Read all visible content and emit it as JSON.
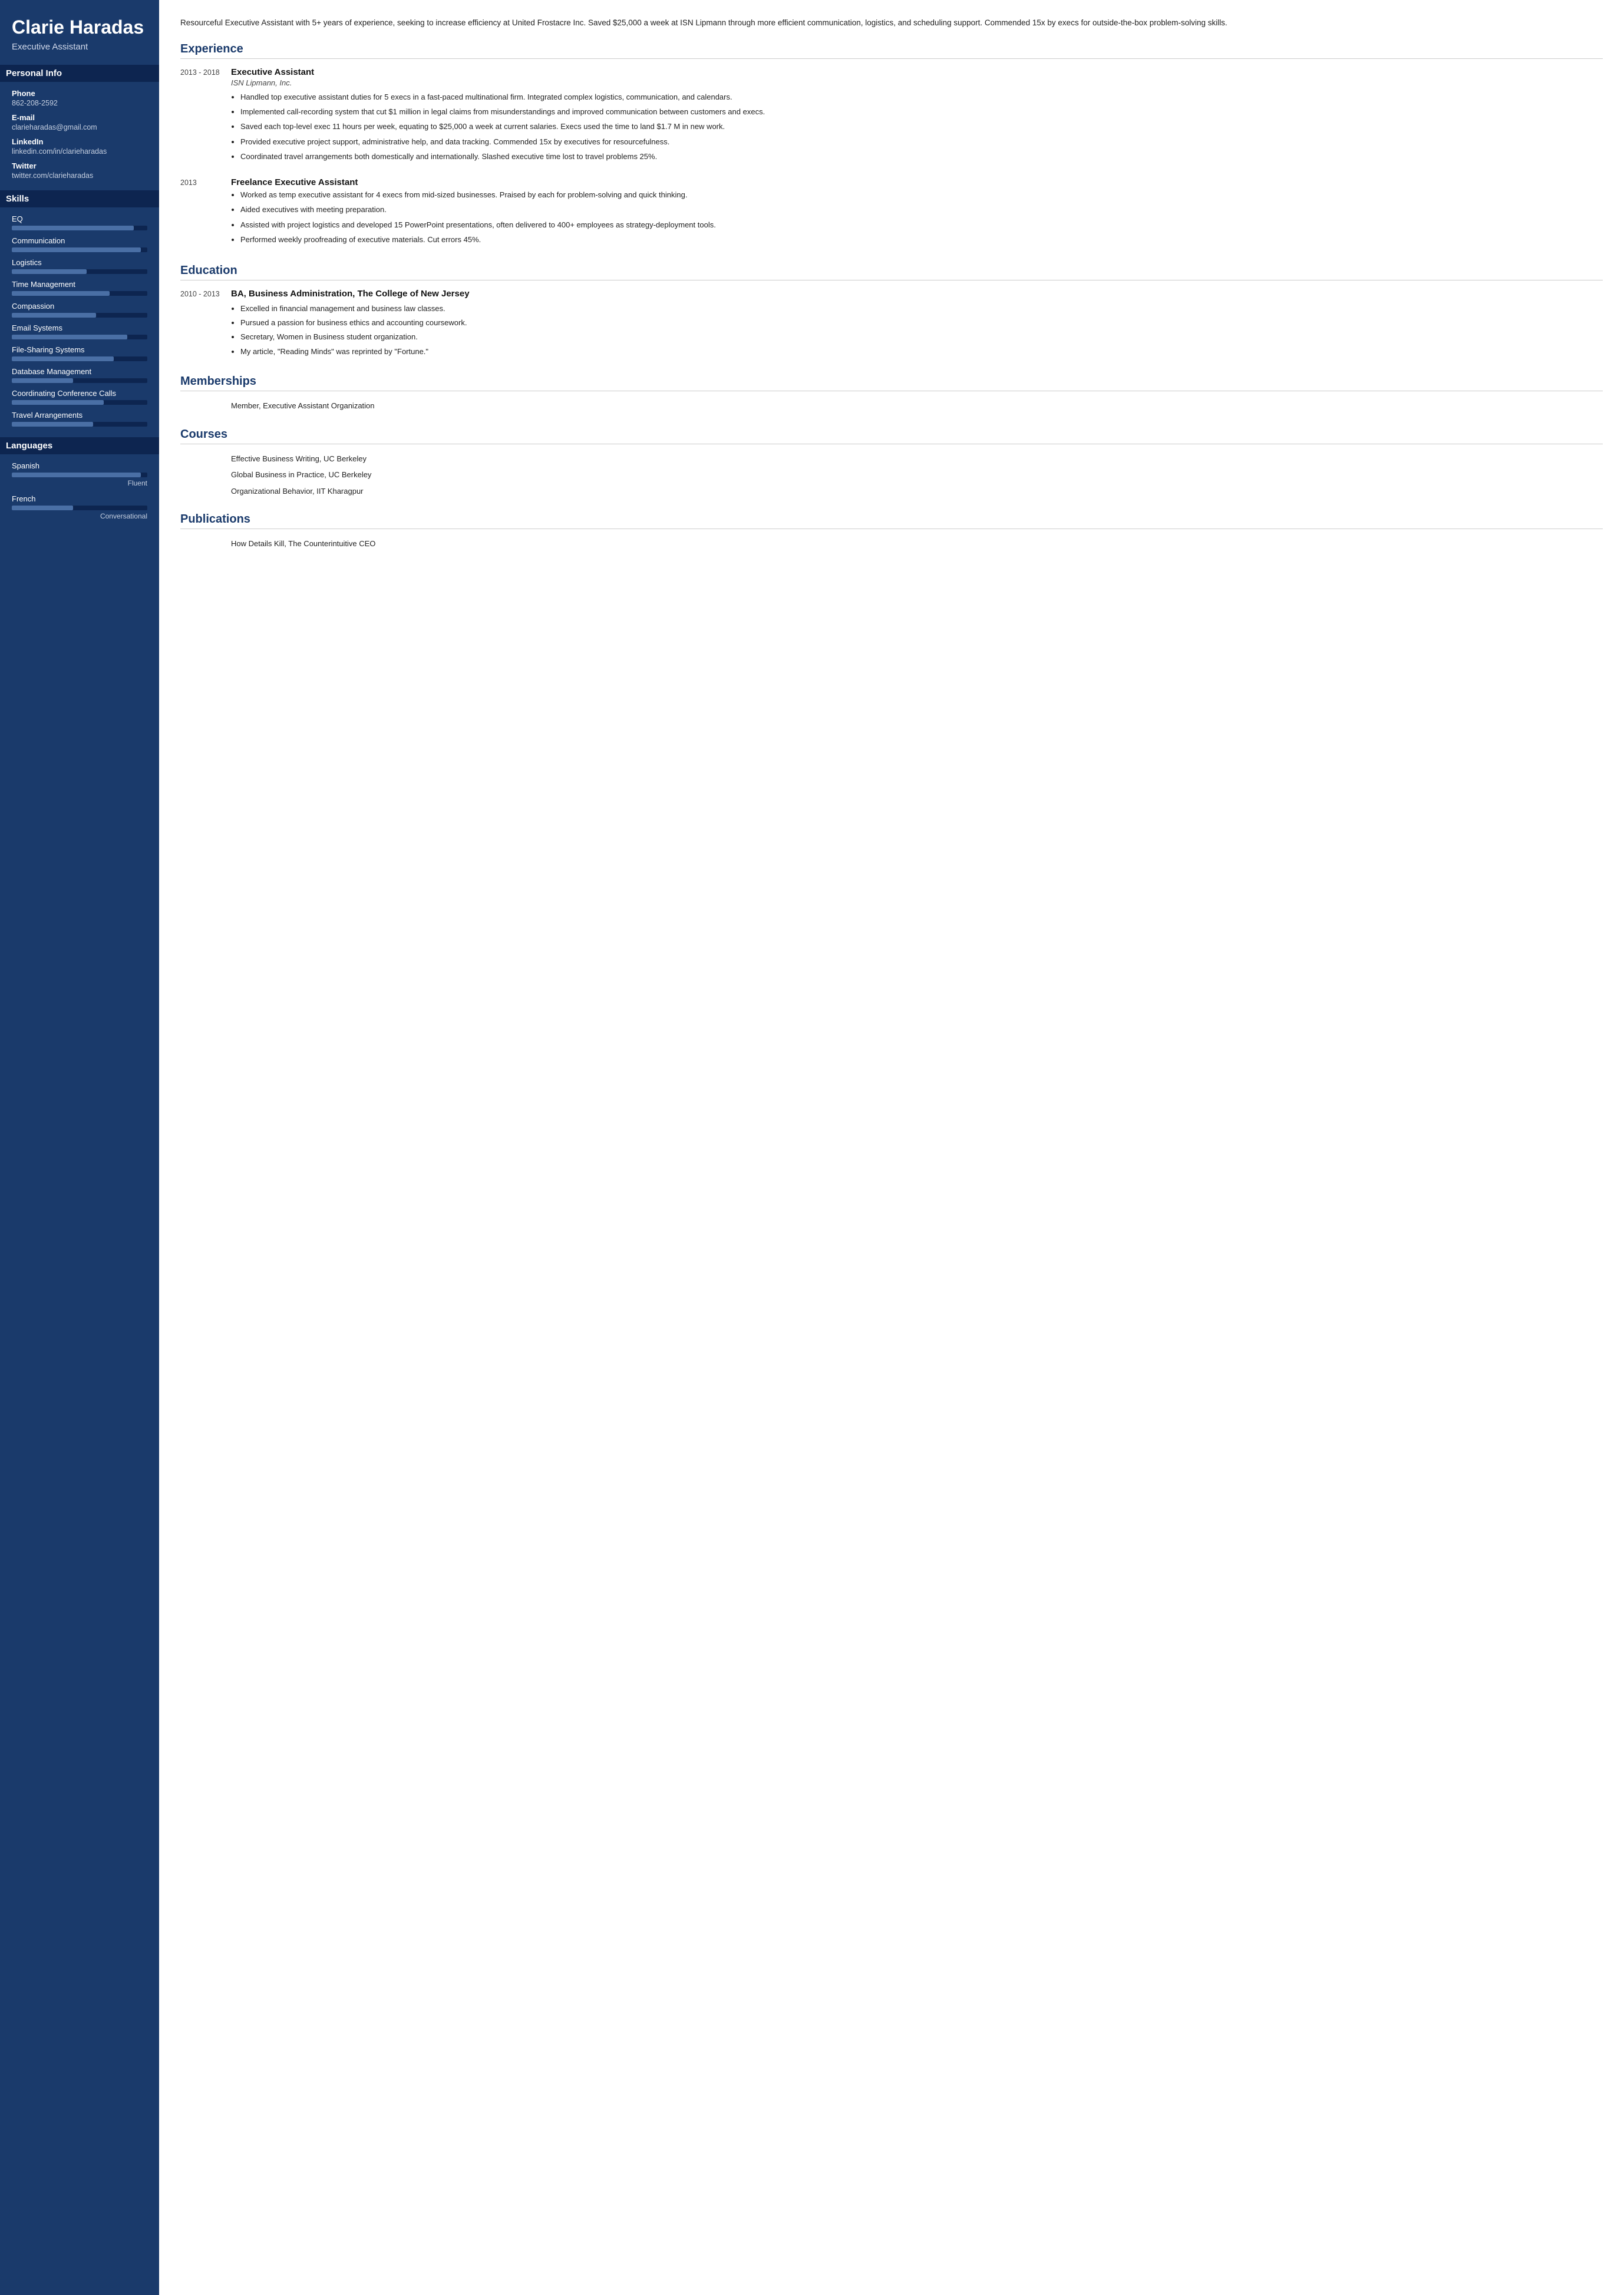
{
  "sidebar": {
    "name": "Clarie Haradas",
    "title": "Executive Assistant",
    "sections": {
      "personal_info": {
        "label": "Personal Info",
        "items": [
          {
            "label": "Phone",
            "value": "862-208-2592"
          },
          {
            "label": "E-mail",
            "value": "clarieharadas@gmail.com"
          },
          {
            "label": "LinkedIn",
            "value": "linkedin.com/in/clarieharadas"
          },
          {
            "label": "Twitter",
            "value": "twitter.com/clarieharadas"
          }
        ]
      },
      "skills": {
        "label": "Skills",
        "items": [
          {
            "name": "EQ",
            "pct": 90
          },
          {
            "name": "Communication",
            "pct": 95
          },
          {
            "name": "Logistics",
            "pct": 55
          },
          {
            "name": "Time Management",
            "pct": 72
          },
          {
            "name": "Compassion",
            "pct": 62
          },
          {
            "name": "Email Systems",
            "pct": 85
          },
          {
            "name": "File-Sharing Systems",
            "pct": 75
          },
          {
            "name": "Database Management",
            "pct": 45
          },
          {
            "name": "Coordinating Conference Calls",
            "pct": 68
          },
          {
            "name": "Travel Arrangements",
            "pct": 60
          }
        ]
      },
      "languages": {
        "label": "Languages",
        "items": [
          {
            "name": "Spanish",
            "pct": 95,
            "level": "Fluent"
          },
          {
            "name": "French",
            "pct": 45,
            "level": "Conversational"
          }
        ]
      }
    }
  },
  "main": {
    "summary": "Resourceful Executive Assistant with 5+ years of experience, seeking to increase efficiency at United Frostacre Inc. Saved $25,000 a week at ISN Lipmann through more efficient communication, logistics, and scheduling support. Commended 15x by execs for outside-the-box problem-solving skills.",
    "experience": {
      "label": "Experience",
      "entries": [
        {
          "dates": "2013 - 2018",
          "title": "Executive Assistant",
          "company": "ISN Lipmann, Inc.",
          "bullets": [
            "Handled top executive assistant duties for 5 execs in a fast-paced multinational firm. Integrated complex logistics, communication, and calendars.",
            "Implemented call-recording system that cut $1 million in legal claims from misunderstandings and improved communication between customers and execs.",
            "Saved each top-level exec 11 hours per week, equating to $25,000 a week at current salaries. Execs used the time to land $1.7 M in new work.",
            "Provided executive project support, administrative help, and data tracking. Commended 15x by executives for resourcefulness.",
            "Coordinated travel arrangements both domestically and internationally. Slashed executive time lost to travel problems 25%."
          ]
        },
        {
          "dates": "2013",
          "title": "Freelance Executive Assistant",
          "company": "",
          "bullets": [
            "Worked as temp executive assistant for 4 execs from mid-sized businesses. Praised by each for problem-solving and quick thinking.",
            "Aided executives with meeting preparation.",
            "Assisted with project logistics and developed 15 PowerPoint presentations, often delivered to 400+ employees as strategy-deployment tools.",
            "Performed weekly proofreading of executive materials. Cut errors 45%."
          ]
        }
      ]
    },
    "education": {
      "label": "Education",
      "entries": [
        {
          "dates": "2010 - 2013",
          "degree": "BA, Business Administration, The College of New Jersey",
          "bullets": [
            "Excelled in financial management and business law classes.",
            "Pursued a passion for business ethics and accounting coursework.",
            "Secretary, Women in Business student organization.",
            "My article, \"Reading Minds\" was reprinted by \"Fortune.\""
          ]
        }
      ]
    },
    "memberships": {
      "label": "Memberships",
      "items": [
        "Member, Executive Assistant Organization"
      ]
    },
    "courses": {
      "label": "Courses",
      "items": [
        "Effective Business Writing, UC Berkeley",
        "Global Business in Practice, UC Berkeley",
        "Organizational Behavior, IIT Kharagpur"
      ]
    },
    "publications": {
      "label": "Publications",
      "items": [
        "How Details Kill, The Counterintuitive CEO"
      ]
    }
  }
}
